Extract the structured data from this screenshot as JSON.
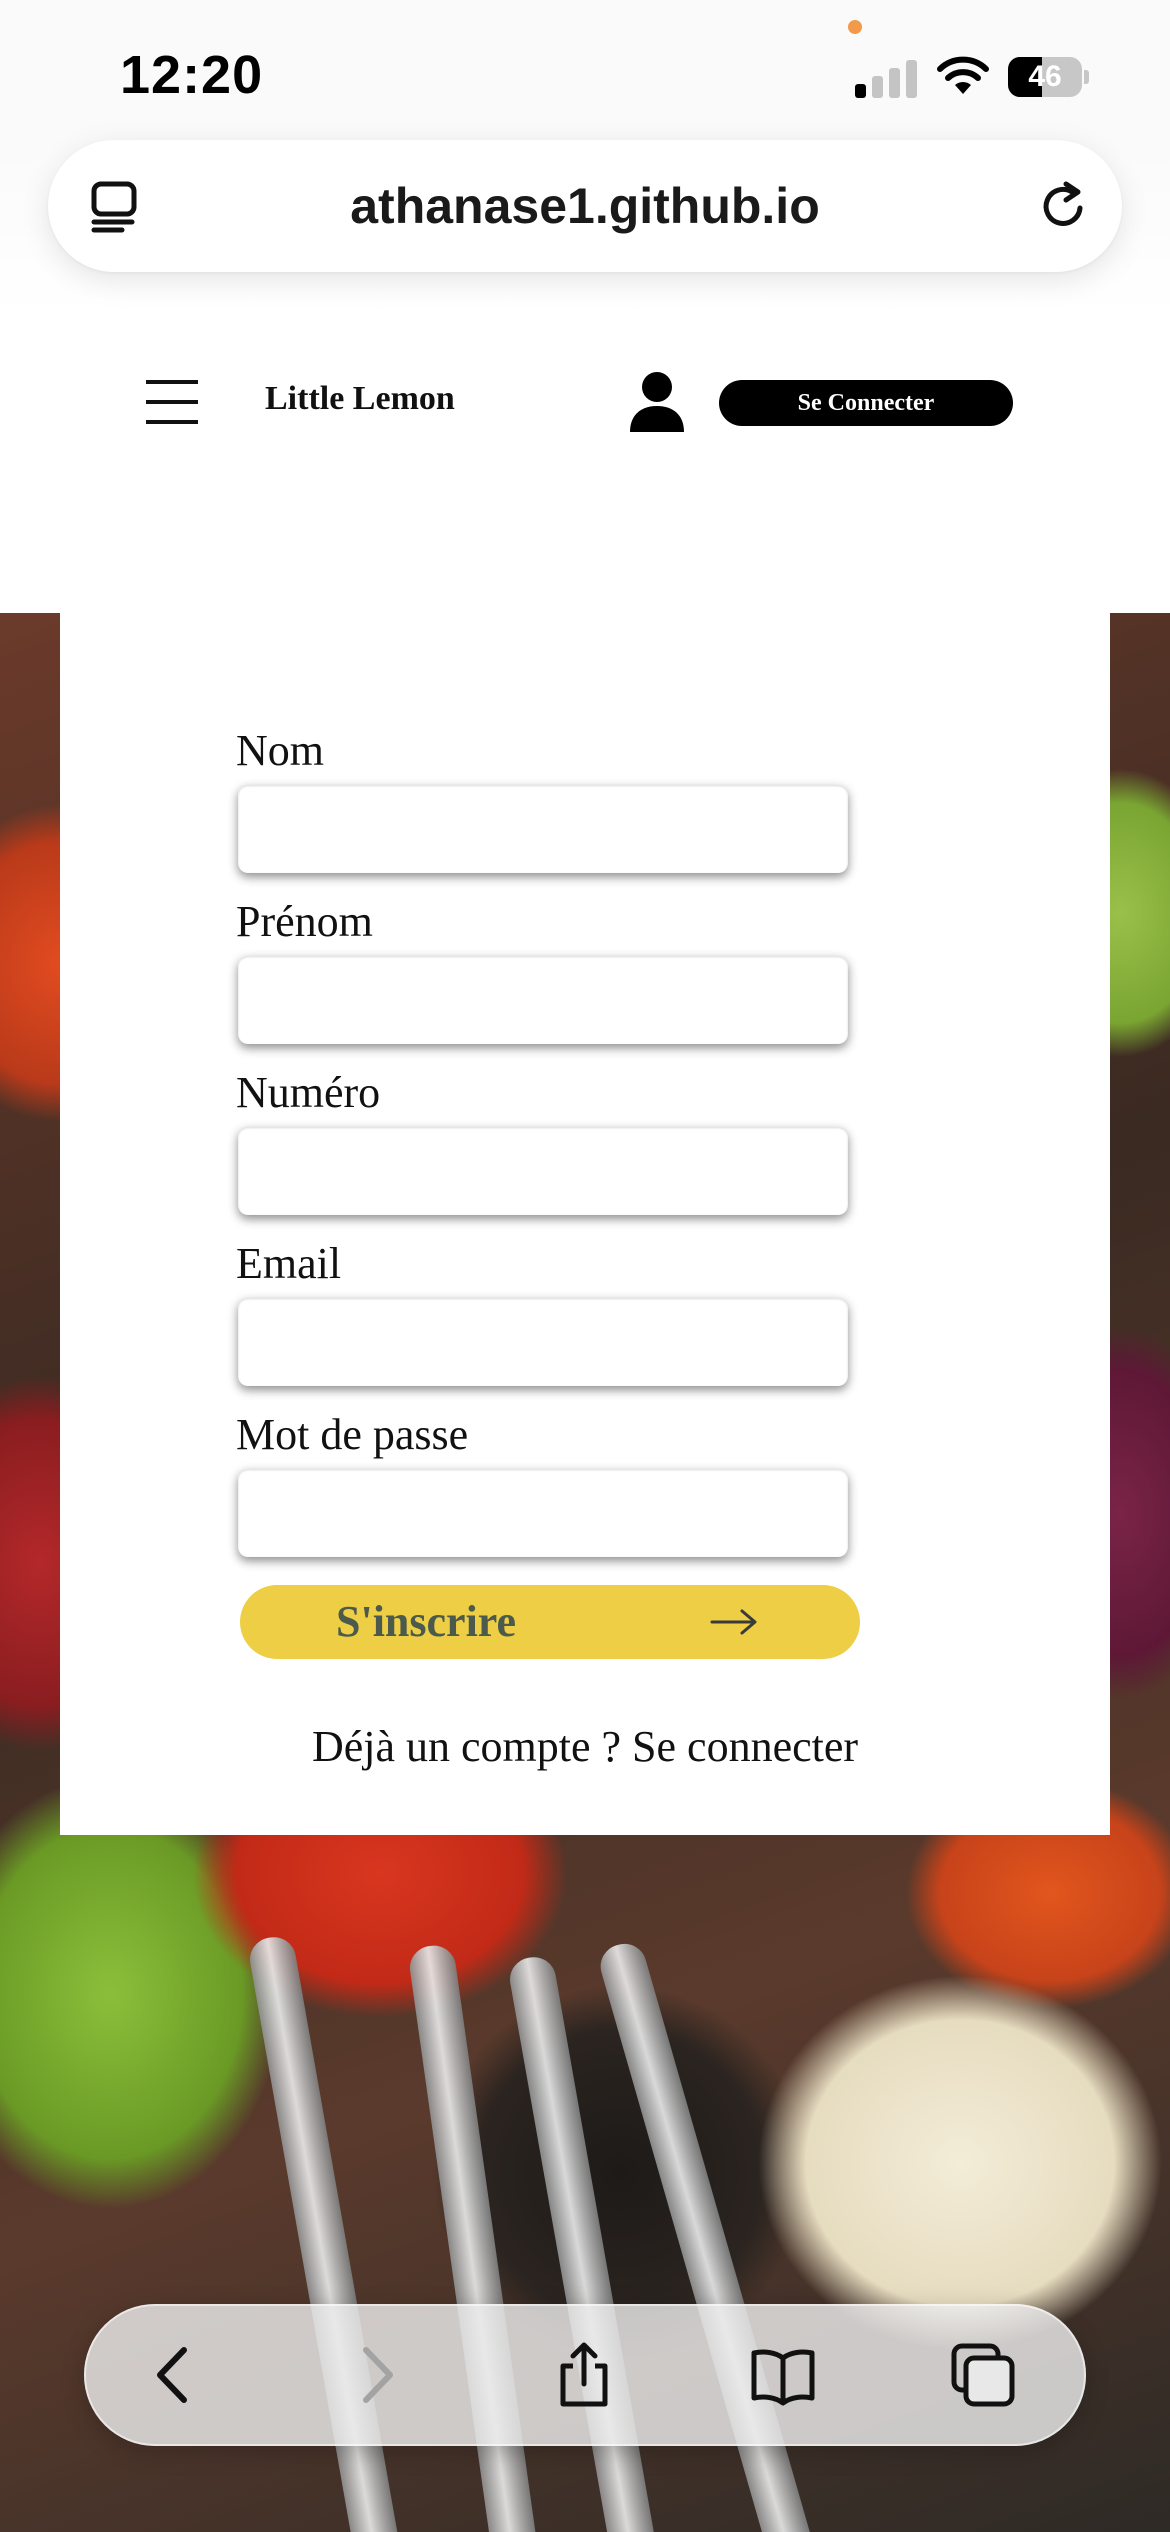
{
  "status_bar": {
    "time": "12:20",
    "battery": "46",
    "battery_fraction": 0.46,
    "signal_bars_active": 1,
    "signal_bars_total": 4
  },
  "browser": {
    "url": "athanase1.github.io",
    "left_icon": "tabs-overview-icon",
    "right_icon": "reload-icon"
  },
  "nav": {
    "menu_icon": "hamburger-menu-icon",
    "brand": "Little Lemon",
    "user_icon": "user-icon",
    "connect_label": "Se Connecter"
  },
  "form": {
    "fields": [
      {
        "label": "Nom",
        "value": "",
        "placeholder": ""
      },
      {
        "label": "Prénom",
        "value": "",
        "placeholder": ""
      },
      {
        "label": "Numéro",
        "value": "",
        "placeholder": ""
      },
      {
        "label": "Email",
        "value": "",
        "placeholder": ""
      },
      {
        "label": "Mot de passe",
        "value": "",
        "placeholder": ""
      }
    ],
    "submit_label": "S'inscrire",
    "submit_icon": "arrow-right-icon",
    "login_prompt": "Déjà un compte ? Se connecter"
  },
  "toolbar": {
    "icons": [
      "back-icon",
      "forward-icon",
      "share-icon",
      "bookmarks-icon",
      "tabs-icon"
    ]
  },
  "colors": {
    "accent_yellow": "#edce44",
    "button_black": "#000000",
    "submit_text": "#4b5a4c"
  }
}
